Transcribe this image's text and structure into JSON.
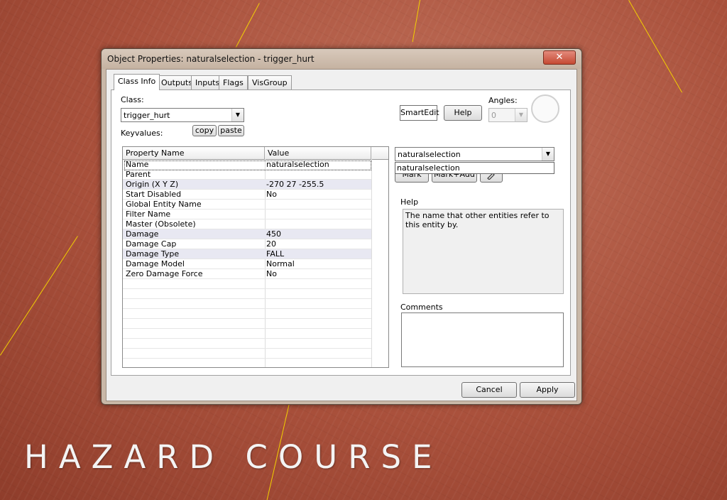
{
  "window": {
    "title": "Object Properties: naturalselection - trigger_hurt",
    "close_label": "✕"
  },
  "tabs": [
    {
      "label": "Class Info",
      "active": true
    },
    {
      "label": "Outputs"
    },
    {
      "label": "Inputs"
    },
    {
      "label": "Flags"
    },
    {
      "label": "VisGroup"
    }
  ],
  "class_info": {
    "class_label": "Class:",
    "class_value": "trigger_hurt",
    "keyvalues_label": "Keyvalues:",
    "copy_label": "copy",
    "paste_label": "paste",
    "smartedit_label": "SmartEdit",
    "help_button_label": "Help",
    "angles_label": "Angles:",
    "angles_value": "0"
  },
  "properties": {
    "headers": {
      "name": "Property Name",
      "value": "Value"
    },
    "rows": [
      {
        "name": "Name",
        "value": "naturalselection"
      },
      {
        "name": "Parent",
        "value": ""
      },
      {
        "name": "Origin (X Y Z)",
        "value": "-270 27 -255.5"
      },
      {
        "name": "Start Disabled",
        "value": "No"
      },
      {
        "name": "Global Entity Name",
        "value": ""
      },
      {
        "name": "Filter Name",
        "value": ""
      },
      {
        "name": "Master (Obsolete)",
        "value": ""
      },
      {
        "name": "Damage",
        "value": "450"
      },
      {
        "name": "Damage Cap",
        "value": "20"
      },
      {
        "name": "Damage Type",
        "value": "FALL"
      },
      {
        "name": "Damage Model",
        "value": "Normal"
      },
      {
        "name": "Zero Damage Force",
        "value": "No"
      }
    ]
  },
  "value_editor": {
    "value": "naturalselection",
    "dropdown_item": "naturalselection",
    "mark_label": "Mark",
    "markadd_label": "Mark+Add"
  },
  "help": {
    "label": "Help",
    "text": "The name that other entities refer to this entity by."
  },
  "comments": {
    "label": "Comments",
    "text": ""
  },
  "footer": {
    "cancel_label": "Cancel",
    "apply_label": "Apply"
  },
  "logo": {
    "text": "HAZARD COURSE"
  }
}
